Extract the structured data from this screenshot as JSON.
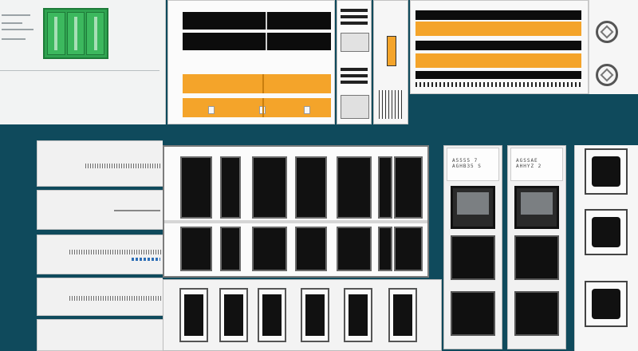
{
  "screen": {
    "background_color": "#0f4a5c",
    "accent_orange": "#f4a42a",
    "accent_green": "#2fa350",
    "module_a_header": "A5555 7\nAGHB35 S",
    "module_b_header": "AGSSAE\nAHHYZ 2"
  },
  "icons": [
    "grid-logo-icon",
    "round-network-icon",
    "round-network-icon"
  ]
}
